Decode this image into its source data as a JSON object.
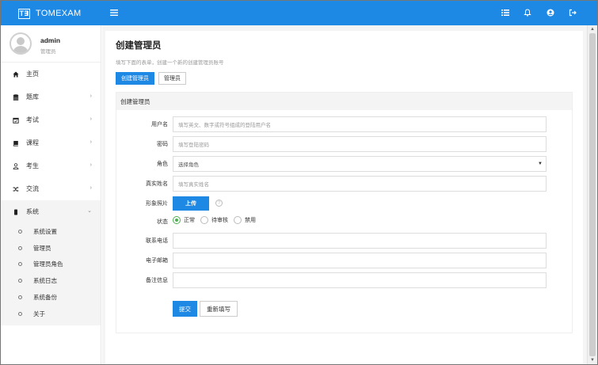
{
  "app": {
    "logo_text": "T∃",
    "name": "TOMEXAM"
  },
  "topbar": {
    "icons": [
      "menu-icon",
      "list-icon",
      "bell-icon",
      "user-icon",
      "logout-icon"
    ]
  },
  "profile": {
    "name": "admin",
    "role": "管理员"
  },
  "sidebar": {
    "items": [
      {
        "label": "主页",
        "icon": "home-icon",
        "has_chevron": false
      },
      {
        "label": "题库",
        "icon": "database-icon",
        "has_chevron": true
      },
      {
        "label": "考试",
        "icon": "calendar-icon",
        "has_chevron": true
      },
      {
        "label": "课程",
        "icon": "book-icon",
        "has_chevron": true
      },
      {
        "label": "考生",
        "icon": "person-icon",
        "has_chevron": true
      },
      {
        "label": "交流",
        "icon": "shuffle-icon",
        "has_chevron": true
      },
      {
        "label": "系统",
        "icon": "phone-icon",
        "has_chevron": true,
        "expanded": true
      }
    ],
    "sub_items": [
      "系统设置",
      "管理员",
      "管理员角色",
      "系统日志",
      "系统备份",
      "关于"
    ]
  },
  "page": {
    "title": "创建管理员",
    "description": "填写下面的表单，创建一个新的创建管理员账号",
    "tabs": [
      "创建管理员",
      "管理员"
    ],
    "card_title": "创建管理员"
  },
  "form": {
    "username": {
      "label": "用户名",
      "placeholder": "填写英文、数字或符号组成的登陆用户名"
    },
    "password": {
      "label": "密码",
      "placeholder": "填写登陆密码"
    },
    "role": {
      "label": "角色",
      "value": "选择角色"
    },
    "realname": {
      "label": "真实姓名",
      "placeholder": "填写真实姓名"
    },
    "photo": {
      "label": "形象照片",
      "button": "上传",
      "help": "?"
    },
    "status": {
      "label": "状态",
      "options": [
        "正常",
        "待审核",
        "禁用"
      ],
      "selected": "正常"
    },
    "phone": {
      "label": "联系电话",
      "placeholder": ""
    },
    "email": {
      "label": "电子邮箱",
      "placeholder": ""
    },
    "note": {
      "label": "备注信息",
      "placeholder": ""
    },
    "submit": "提交",
    "reset": "重新填写"
  }
}
